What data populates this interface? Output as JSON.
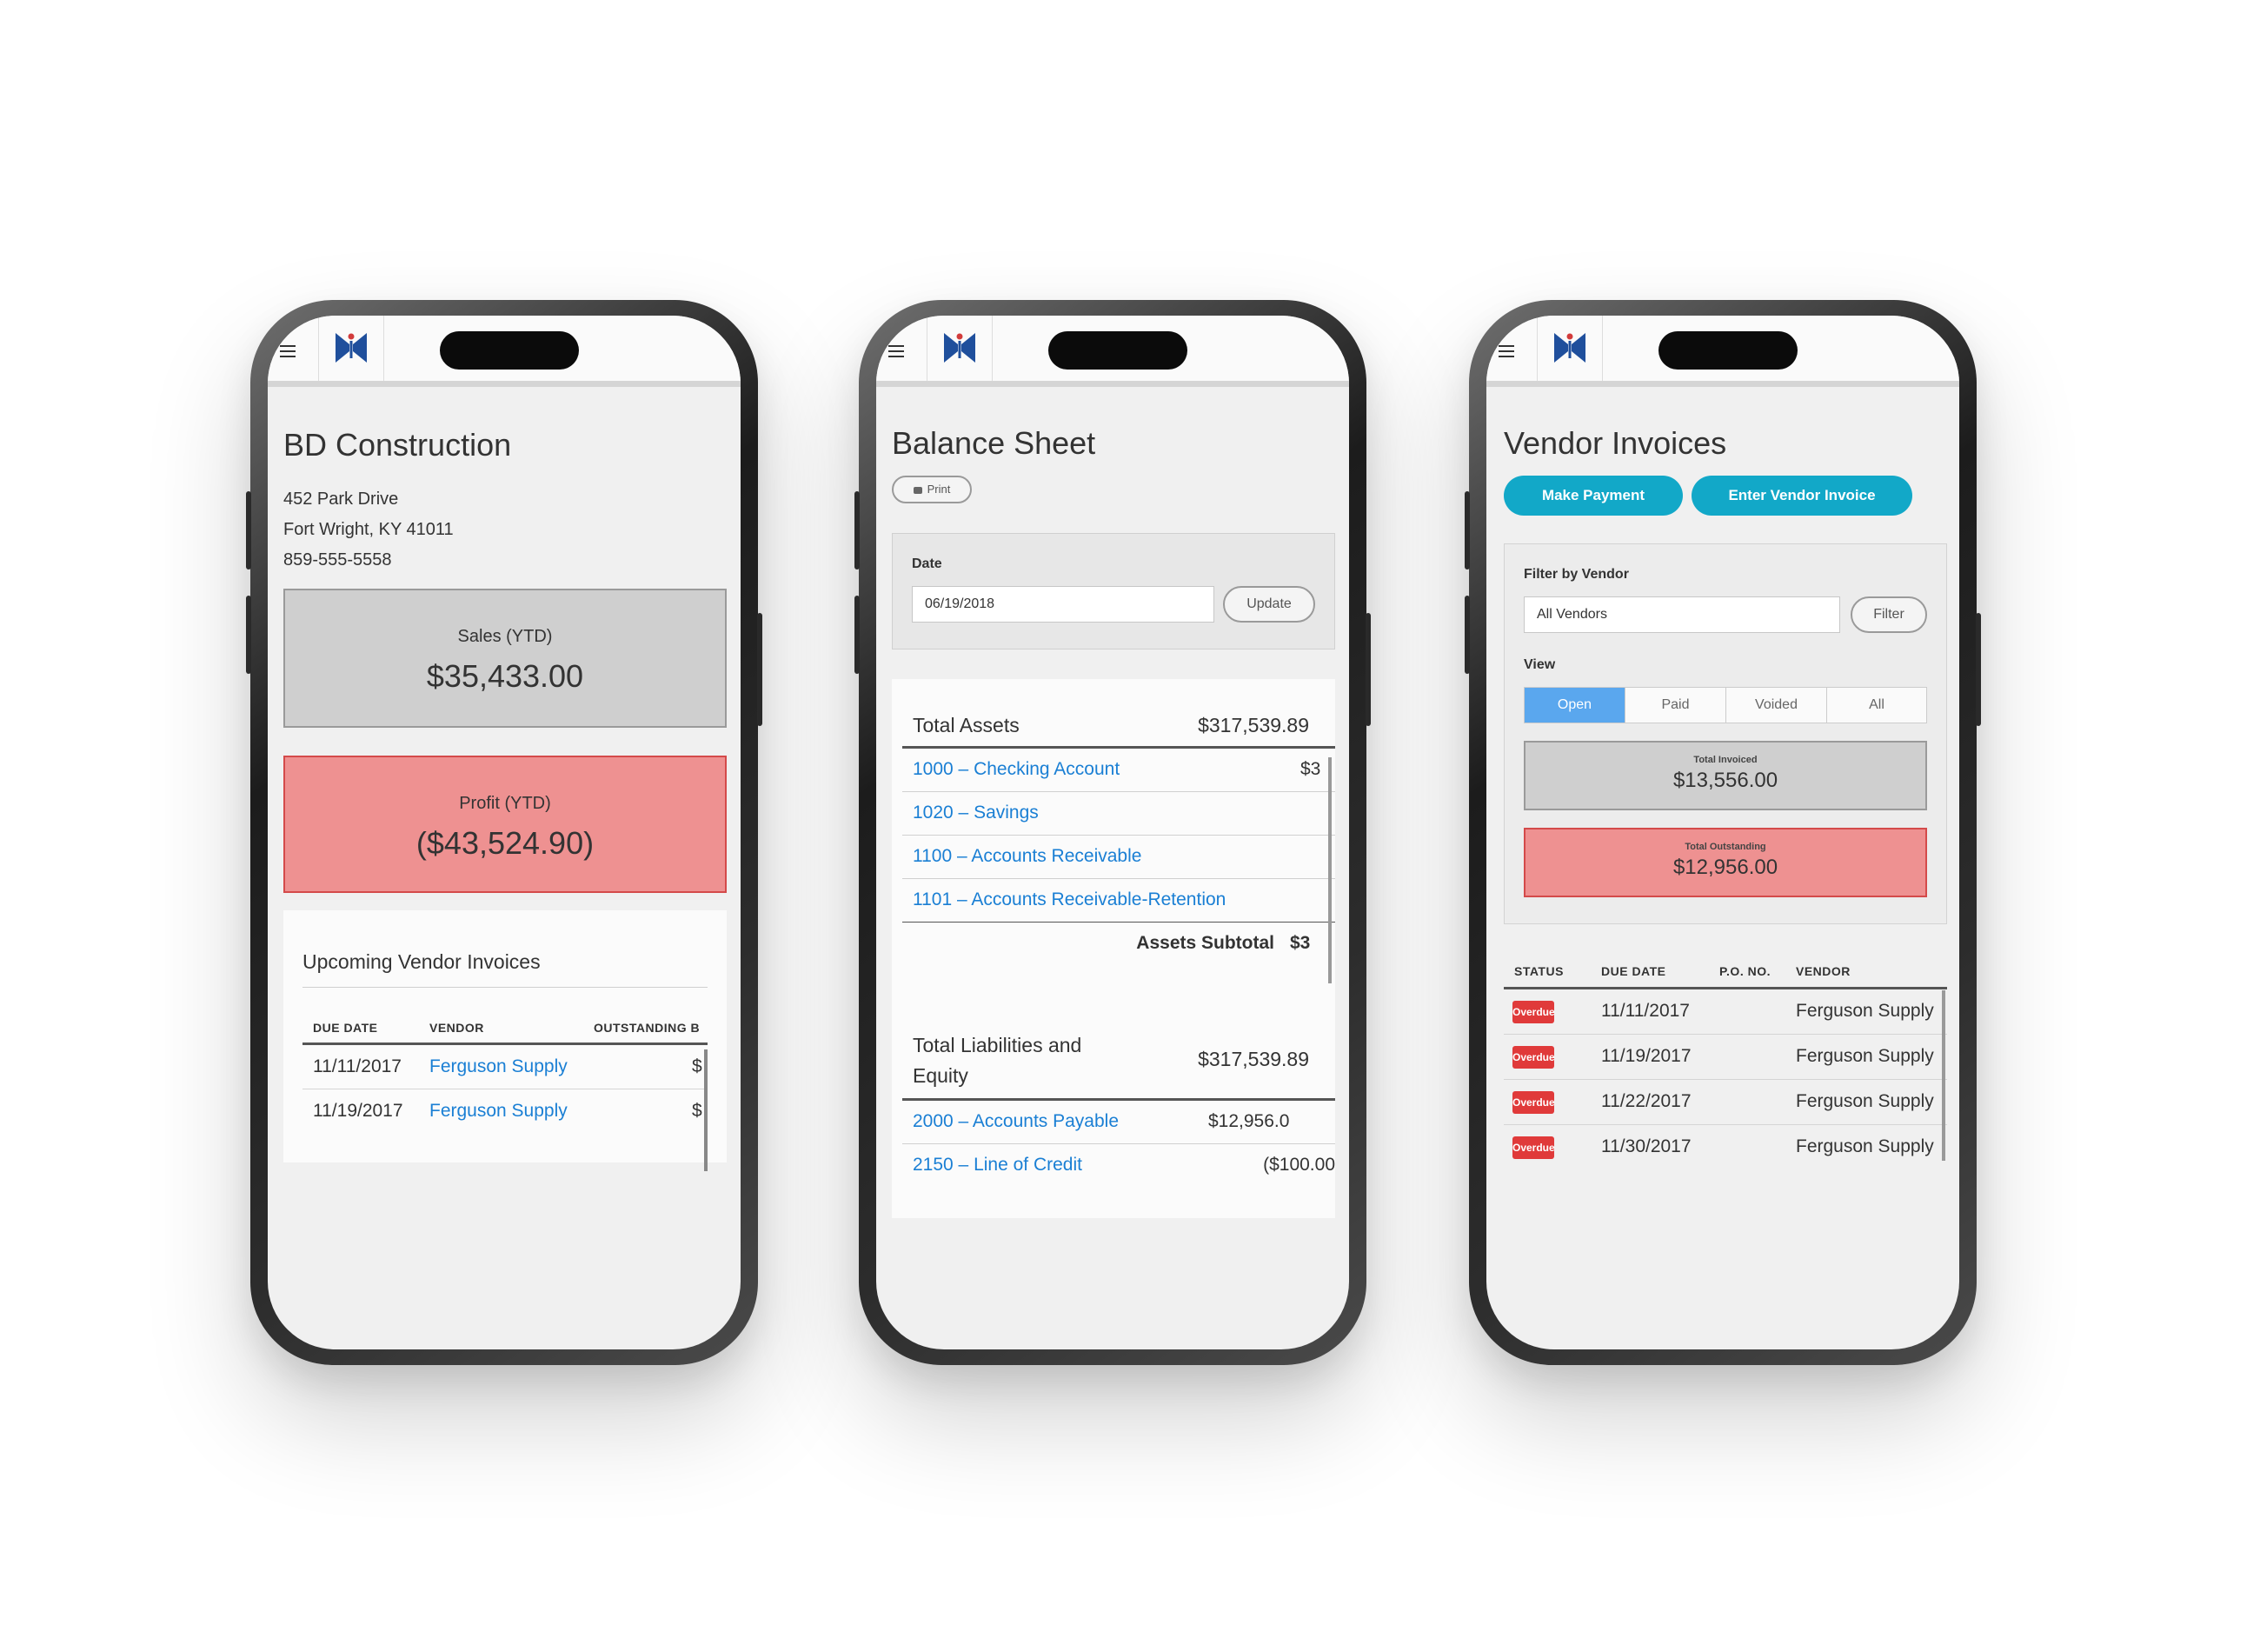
{
  "phone1": {
    "company_name": "BD Construction",
    "address_line1": "452 Park Drive",
    "address_line2": "Fort Wright, KY 41011",
    "phone": "859-555-5558",
    "sales_label": "Sales (YTD)",
    "sales_value": "$35,433.00",
    "profit_label": "Profit (YTD)",
    "profit_value": "($43,524.90)",
    "upcoming_title": "Upcoming Vendor Invoices",
    "columns": [
      "DUE DATE",
      "VENDOR",
      "OUTSTANDING B"
    ],
    "rows": [
      {
        "due_date": "11/11/2017",
        "vendor": "Ferguson Supply",
        "amount": "$"
      },
      {
        "due_date": "11/19/2017",
        "vendor": "Ferguson Supply",
        "amount": "$"
      }
    ]
  },
  "phone2": {
    "title": "Balance Sheet",
    "print_label": "Print",
    "date_label": "Date",
    "date_value": "06/19/2018",
    "update_label": "Update",
    "total_assets_label": "Total Assets",
    "total_assets_value": "$317,539.89",
    "asset_rows": [
      {
        "label": "1000 – Checking Account",
        "value": "$3"
      },
      {
        "label": "1020 – Savings",
        "value": ""
      },
      {
        "label": "1100 – Accounts Receivable",
        "value": ""
      },
      {
        "label": "1101 – Accounts Receivable-Retention",
        "value": ""
      }
    ],
    "assets_subtotal_label": "Assets Subtotal",
    "assets_subtotal_value": "$3",
    "total_liabilities_label_line1": "Total Liabilities and",
    "total_liabilities_label_line2": "Equity",
    "total_liabilities_value": "$317,539.89",
    "liability_rows": [
      {
        "label": "2000 – Accounts Payable",
        "value": "$12,956.0"
      },
      {
        "label": "2150 – Line of Credit",
        "value": "($100.00"
      }
    ]
  },
  "phone3": {
    "title": "Vendor Invoices",
    "make_payment_label": "Make Payment",
    "enter_invoice_label": "Enter Vendor Invoice",
    "filter_by_label": "Filter by Vendor",
    "vendor_select_value": "All Vendors",
    "filter_button_label": "Filter",
    "view_label": "View",
    "view_options": [
      "Open",
      "Paid",
      "Voided",
      "All"
    ],
    "total_invoiced_label": "Total Invoiced",
    "total_invoiced_value": "$13,556.00",
    "total_outstanding_label": "Total Outstanding",
    "total_outstanding_value": "$12,956.00",
    "columns": [
      "STATUS",
      "DUE DATE",
      "P.O. NO.",
      "VENDOR"
    ],
    "rows": [
      {
        "status": "Overdue",
        "due_date": "11/11/2017",
        "po": "",
        "vendor": "Ferguson Supply"
      },
      {
        "status": "Overdue",
        "due_date": "11/19/2017",
        "po": "",
        "vendor": "Ferguson Supply"
      },
      {
        "status": "Overdue",
        "due_date": "11/22/2017",
        "po": "",
        "vendor": "Ferguson Supply"
      },
      {
        "status": "Overdue",
        "due_date": "11/30/2017",
        "po": "",
        "vendor": "Ferguson Supply"
      }
    ]
  },
  "icons": {
    "menu": "hamburger-menu-icon",
    "logo": "butterfly-logo",
    "print": "printer-icon"
  },
  "colors": {
    "link": "#1a7fd4",
    "teal_button": "#12a8c8",
    "kpi_gray": "#cfcfcf",
    "kpi_red": "#ee9191",
    "overdue_badge": "#e03a3a",
    "segment_active": "#5aa7ee"
  }
}
